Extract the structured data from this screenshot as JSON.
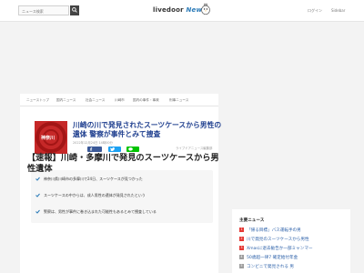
{
  "header": {
    "search_placeholder": "ニュース検索",
    "logo_brand": "livedoor",
    "logo_news": "News",
    "login": "ログイン",
    "signup": "Sidebar"
  },
  "nav": {
    "items": [
      "ニューストップ",
      "国内ニュース",
      "社会ニュース",
      "川崎市",
      "国内の事件・事故",
      "刑事ニュース"
    ]
  },
  "article": {
    "hero_label": "神奈川",
    "title": "川崎の川で発見されたスーツケースから男性の遺体 警察が事件とみて捜査",
    "pubdate": "2022年12月24日 14時00分",
    "source": "ライブドアニュース編集部",
    "share_fb_count": "0",
    "summary_points": [
      "神奈川県川崎市の多摩川で24日、スーツケースが見つかった",
      "スーツケースの中からは、成人男性の遺体が発見されたという",
      "警察は、男性が事件に巻き込まれた可能性もあるとみて捜査している"
    ],
    "breaking_headline": "【速報】川崎・多摩川で発見のスーツケースから男性遺体"
  },
  "sidebar": {
    "heading": "主要ニュース",
    "items": [
      {
        "rank": "1",
        "text": "「帰る目標」バス運転手の男",
        "color": "#e53935"
      },
      {
        "rank": "2",
        "text": "川で発見のスーツケースから男性",
        "color": "#e53935"
      },
      {
        "rank": "3",
        "text": "Xmasに退去勧告か一部ミャンマー",
        "color": "#e53935"
      },
      {
        "rank": "4",
        "text": "50歳超一律7 確定給付年金",
        "color": "#9e9e9e"
      },
      {
        "rank": "5",
        "text": "コンビニで発見される 男",
        "color": "#9e9e9e"
      }
    ]
  },
  "colors": {
    "title": "#1f3f8f",
    "hero": "#c62828",
    "facebook": "#3b5998",
    "twitter": "#1da1f2",
    "line": "#00c300",
    "check": "#2a7ab8"
  },
  "icons": {
    "search": "search-icon",
    "bird": "bird-mascot-icon",
    "check": "check-icon",
    "facebook": "facebook-icon",
    "twitter": "twitter-icon",
    "line": "line-icon"
  }
}
